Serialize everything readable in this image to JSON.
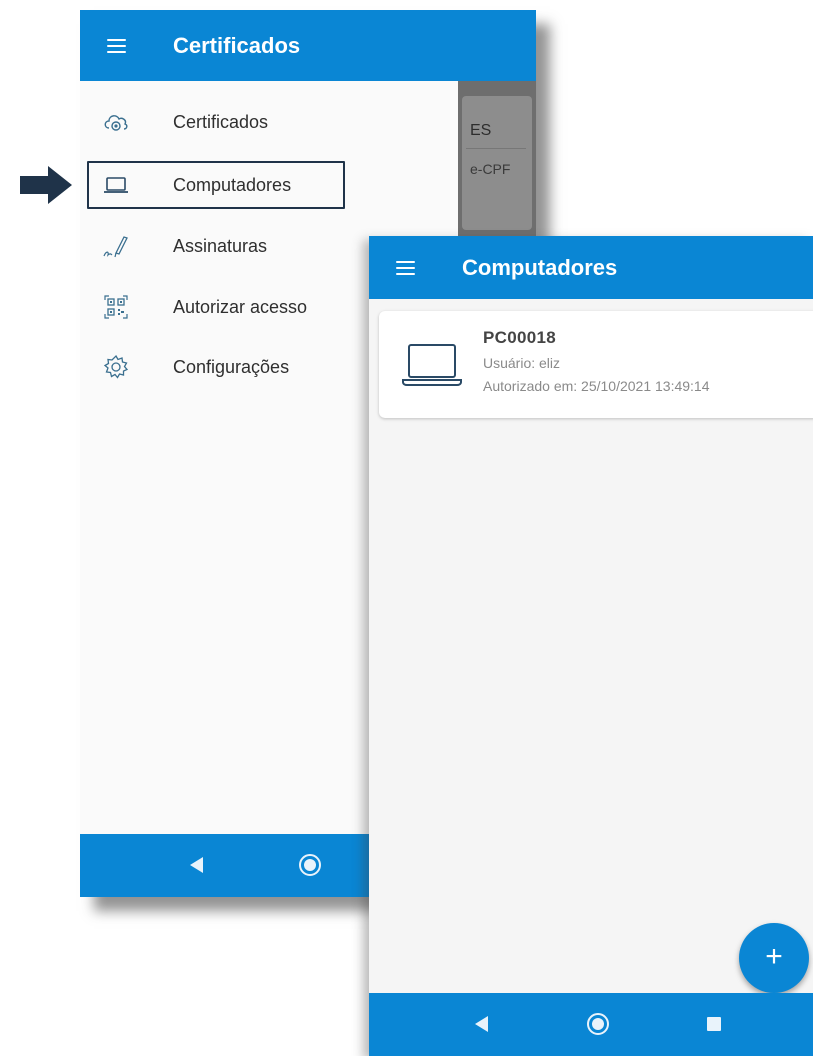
{
  "colors": {
    "primary": "#0a86d4",
    "arrow": "#1f3349",
    "highlight_border": "#1f3349"
  },
  "drawer_screen": {
    "app_bar": {
      "title": "Certificados",
      "menu_icon": "hamburger-menu-icon"
    },
    "background_card": {
      "title_fragment": "ES",
      "subtitle_fragment": "e-CPF"
    },
    "nav_items": [
      {
        "label": "Certificados",
        "icon": "cloud-certificate-icon"
      },
      {
        "label": "Computadores",
        "icon": "laptop-icon",
        "highlighted": true
      },
      {
        "label": "Assinaturas",
        "icon": "signature-pen-icon"
      },
      {
        "label": "Autorizar acesso",
        "icon": "qr-code-icon"
      },
      {
        "label": "Configurações",
        "icon": "gear-icon"
      }
    ],
    "system_nav": [
      "back-icon",
      "home-icon"
    ]
  },
  "computers_screen": {
    "app_bar": {
      "title": "Computadores",
      "menu_icon": "hamburger-menu-icon"
    },
    "computers": [
      {
        "name": "PC00018",
        "user": "Usuário: eliz",
        "authorized": "Autorizado em: 25/10/2021 13:49:14",
        "icon": "laptop-icon"
      }
    ],
    "fab_label": "+",
    "system_nav": [
      "back-icon",
      "home-icon",
      "recent-apps-icon"
    ]
  }
}
